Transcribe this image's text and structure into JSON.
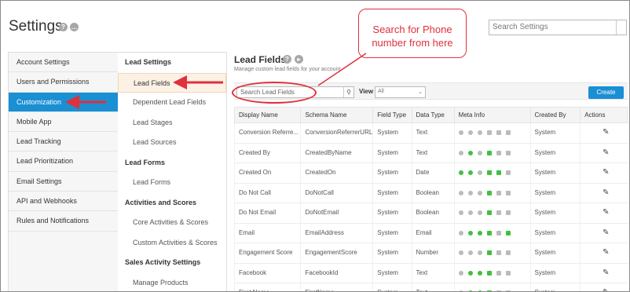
{
  "header": {
    "title": "Settings",
    "help_icon": "?",
    "search_placeholder": "Search Settings"
  },
  "leftnav": {
    "items": [
      {
        "label": "Account Settings"
      },
      {
        "label": "Users and Permissions"
      },
      {
        "label": "Customization",
        "active": true
      },
      {
        "label": "Mobile App"
      },
      {
        "label": "Lead Tracking"
      },
      {
        "label": "Lead Prioritization"
      },
      {
        "label": "Email Settings"
      },
      {
        "label": "API and Webhooks"
      },
      {
        "label": "Rules and Notifications"
      }
    ]
  },
  "subnav": {
    "sections": [
      {
        "title": "Lead Settings",
        "items": [
          "Lead Fields",
          "Dependent Lead Fields",
          "Lead Stages",
          "Lead Sources"
        ]
      },
      {
        "title": "Lead Forms",
        "items": [
          "Lead Forms"
        ]
      },
      {
        "title": "Activities and Scores",
        "items": [
          "Core Activities & Scores",
          "Custom Activities & Scores"
        ]
      },
      {
        "title": "Sales Activity Settings",
        "items": [
          "Manage Products"
        ]
      }
    ],
    "active_item": "Lead Fields"
  },
  "main": {
    "title": "Lead Fields",
    "subtitle": "Manage custom lead fields for your account",
    "search_placeholder": "Search Lead Fields",
    "view_label": "View",
    "view_value": "All",
    "create_label": "Create",
    "columns": [
      "Display Name",
      "Schema Name",
      "Field Type",
      "Data Type",
      "Meta Info",
      "Created By",
      "Actions"
    ],
    "rows": [
      {
        "display": "Conversion Referre...",
        "schema": "ConversionReferrerURL",
        "field_type": "System",
        "data_type": "Text",
        "created_by": "System",
        "meta": [
          0,
          0,
          0,
          0,
          0,
          0
        ]
      },
      {
        "display": "Created By",
        "schema": "CreatedByName",
        "field_type": "System",
        "data_type": "Text",
        "created_by": "System",
        "meta": [
          0,
          1,
          0,
          1,
          0,
          0
        ]
      },
      {
        "display": "Created On",
        "schema": "CreatedOn",
        "field_type": "System",
        "data_type": "Date",
        "created_by": "System",
        "meta": [
          1,
          1,
          0,
          1,
          1,
          0
        ]
      },
      {
        "display": "Do Not Call",
        "schema": "DoNotCall",
        "field_type": "System",
        "data_type": "Boolean",
        "created_by": "System",
        "meta": [
          0,
          0,
          0,
          1,
          0,
          0
        ]
      },
      {
        "display": "Do Not Email",
        "schema": "DoNotEmail",
        "field_type": "System",
        "data_type": "Boolean",
        "created_by": "System",
        "meta": [
          0,
          0,
          0,
          1,
          0,
          0
        ]
      },
      {
        "display": "Email",
        "schema": "EmailAddress",
        "field_type": "System",
        "data_type": "Email",
        "created_by": "System",
        "meta": [
          0,
          1,
          1,
          1,
          0,
          1
        ]
      },
      {
        "display": "Engagement Score",
        "schema": "EngagementScore",
        "field_type": "System",
        "data_type": "Number",
        "created_by": "System",
        "meta": [
          0,
          0,
          0,
          1,
          0,
          0
        ]
      },
      {
        "display": "Facebook",
        "schema": "FacebookId",
        "field_type": "System",
        "data_type": "Text",
        "created_by": "System",
        "meta": [
          0,
          1,
          1,
          1,
          0,
          0
        ]
      },
      {
        "display": "First Name",
        "schema": "FirstName",
        "field_type": "System",
        "data_type": "Text",
        "created_by": "System",
        "meta": [
          0,
          1,
          1,
          1,
          0,
          0
        ]
      }
    ]
  },
  "annotation": {
    "callout_text": "Search for Phone number from here",
    "color": "#e0303a"
  }
}
